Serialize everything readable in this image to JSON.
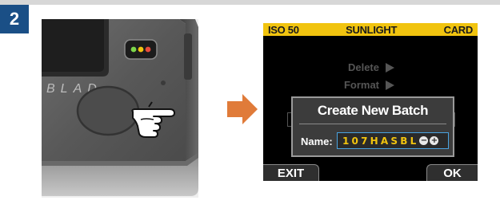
{
  "step": {
    "number": "2"
  },
  "camera": {
    "brand_text": "BLAD",
    "led_colors": [
      "#7dd64a",
      "#f1c40f",
      "#e74c3c"
    ]
  },
  "arrow": {
    "color": "#e07b39"
  },
  "lcd": {
    "status_bar": {
      "iso": "ISO 50",
      "white_balance": "SUNLIGHT",
      "storage": "CARD",
      "color": "#f1c40f"
    },
    "menu": [
      {
        "label": "Delete"
      },
      {
        "label": "Format"
      }
    ],
    "dialog": {
      "title": "Create New Batch",
      "name_label": "Name:",
      "name_value": "107HASBL",
      "minus_glyph": "−",
      "plus_glyph": "+",
      "field_border_color": "#4aa3e0"
    },
    "softkeys": {
      "left": "EXIT",
      "right": "OK"
    }
  }
}
